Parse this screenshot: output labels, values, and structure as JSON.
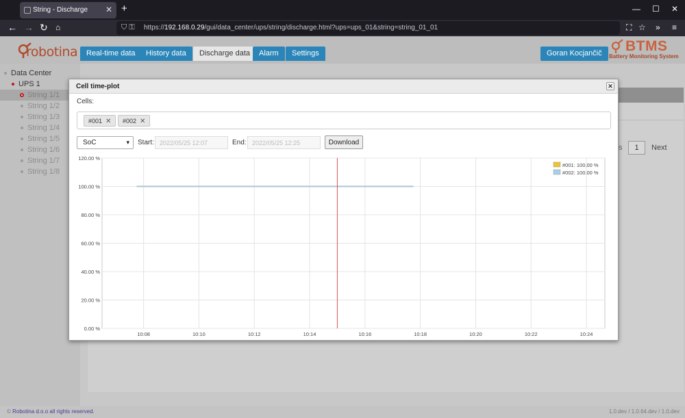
{
  "browser": {
    "tab_title": "String - Discharge",
    "url_prefix": "https://",
    "url_host": "192.168.0.29",
    "url_path": "/gui/data_center/ups/string/discharge.html?ups=ups_01&string=string_01_01"
  },
  "app": {
    "logo_text": "robotina",
    "nav_tabs": [
      "Real-time data",
      "History data",
      "Discharge data",
      "Alarm",
      "Settings"
    ],
    "active_tab": "Discharge data",
    "user_name": "Goran Kocjančič",
    "brand_title": "BTMS",
    "brand_subtitle": "Battery Monitoring System"
  },
  "sidebar": {
    "root": "Data Center",
    "ups": "UPS 1",
    "strings": [
      "String 1/1",
      "String 1/2",
      "String 1/3",
      "String 1/4",
      "String 1/5",
      "String 1/6",
      "String 1/7",
      "String 1/8"
    ],
    "selected": "String 1/1"
  },
  "background": {
    "page_number": "1",
    "next_label": "Next",
    "prev_fragment": "s"
  },
  "footer": {
    "company": "Robotina d.o.o",
    "rights": " all rights reserved.",
    "version": "1.0.dev / 1.0.64.dev / 1.0.dev"
  },
  "modal": {
    "title": "Cell time-plot",
    "cells_label": "Cells:",
    "cells": [
      "#001",
      "#002"
    ],
    "metric": "SoC",
    "start_label": "Start:",
    "start_value": "2022/05/25 12:07",
    "end_label": "End:",
    "end_value": "2022/05/25 12:25",
    "download_label": "Download"
  },
  "chart_data": {
    "type": "line",
    "title": "",
    "xlabel": "",
    "ylabel": "",
    "x_ticks": [
      "10:08",
      "10:10",
      "10:12",
      "10:14",
      "10:16",
      "10:18",
      "10:20",
      "10:22",
      "10:24"
    ],
    "y_ticks": [
      "0.00 %",
      "20.00 %",
      "40.00 %",
      "60.00 %",
      "80.00 %",
      "100.00 %",
      "120.00 %"
    ],
    "ylim": [
      0,
      120
    ],
    "x_range_minutes": [
      "10:06:30",
      "10:24:40"
    ],
    "grid": true,
    "legend_position": "top-right",
    "cursor_time": "10:15",
    "series": [
      {
        "name": "#001: 100.00 %",
        "color": "#f0c232",
        "x": [
          "10:07:45",
          "10:17:45"
        ],
        "values": [
          100,
          100
        ]
      },
      {
        "name": "#002: 100.00 %",
        "color": "#a8cfe8",
        "x": [
          "10:07:45",
          "10:17:45"
        ],
        "values": [
          100,
          100
        ]
      }
    ],
    "cursor_color": "#d9534f"
  }
}
